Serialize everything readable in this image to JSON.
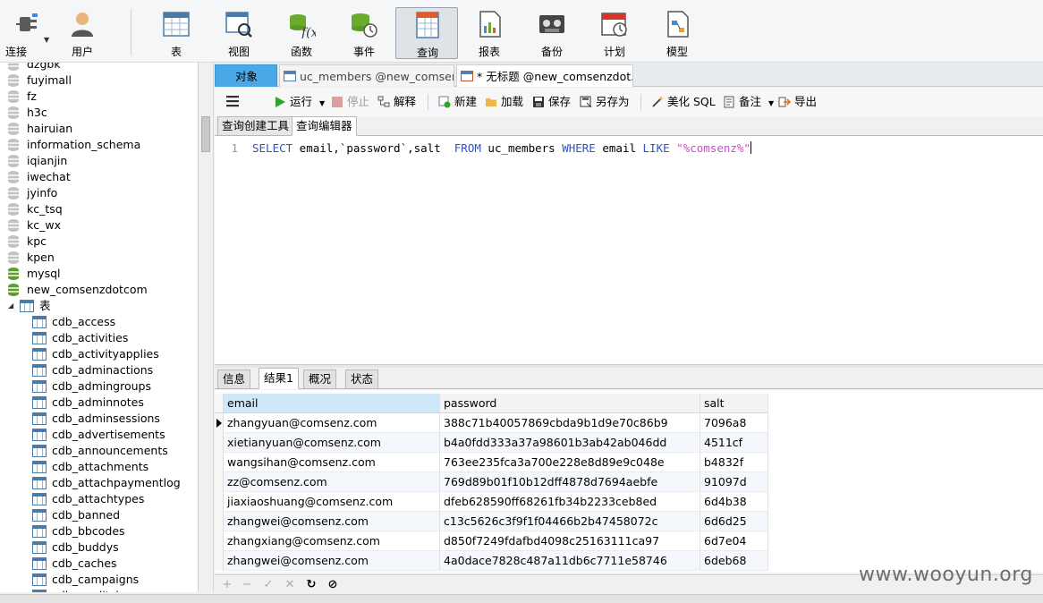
{
  "toolbar": {
    "connect": "连接",
    "user": "用户",
    "table": "表",
    "view": "视图",
    "function": "函数",
    "event": "事件",
    "query": "查询",
    "report": "报表",
    "backup": "备份",
    "schedule": "计划",
    "model": "模型"
  },
  "tree": {
    "top_partial": "dzgbk",
    "databases": [
      "fuyimall",
      "fz",
      "h3c",
      "hairuian",
      "information_schema",
      "iqianjin",
      "iwechat",
      "jyinfo",
      "kc_tsq",
      "kc_wx",
      "kpc",
      "kpen",
      "mysql",
      "new_comsenzdotcom"
    ],
    "tables_node": "表",
    "tables": [
      "cdb_access",
      "cdb_activities",
      "cdb_activityapplies",
      "cdb_adminactions",
      "cdb_admingroups",
      "cdb_adminnotes",
      "cdb_adminsessions",
      "cdb_advertisements",
      "cdb_announcements",
      "cdb_attachments",
      "cdb_attachpaymentlog",
      "cdb_attachtypes",
      "cdb_banned",
      "cdb_bbcodes",
      "cdb_buddys",
      "cdb_caches",
      "cdb_campaigns",
      "cdb_creditslog"
    ]
  },
  "tabs": {
    "objects": "对象",
    "tab1": "uc_members @new_comsen...",
    "tab2": "* 无标题 @new_comsenzdot..."
  },
  "qtoolbar": {
    "run": "运行",
    "stop": "停止",
    "explain": "解释",
    "new": "新建",
    "load": "加载",
    "save": "保存",
    "save_as": "另存为",
    "beautify": "美化 SQL",
    "comment": "备注",
    "export": "导出"
  },
  "editor_tabs": {
    "builder": "查询创建工具",
    "editor": "查询编辑器"
  },
  "editor": {
    "line_no": "1",
    "kw_select": "SELECT",
    "cols": " email,`password`,salt  ",
    "kw_from": "FROM",
    "table": " uc_members ",
    "kw_where": "WHERE",
    "field": " email ",
    "kw_like": "LIKE",
    "pattern": "\"%comsenz%\""
  },
  "result_tabs": {
    "info": "信息",
    "result1": "结果1",
    "overview": "概况",
    "status": "状态"
  },
  "grid": {
    "columns": [
      "email",
      "password",
      "salt"
    ],
    "rows": [
      [
        "zhangyuan@comsenz.com",
        "388c71b40057869cbda9b1d9e70c86b9",
        "7096a8"
      ],
      [
        "xietianyuan@comsenz.com",
        "b4a0fdd333a37a98601b3ab42ab046dd",
        "4511cf"
      ],
      [
        "wangsihan@comsenz.com",
        "763ee235fca3a700e228e8d89e9c048e",
        "b4832f"
      ],
      [
        "zz@comsenz.com",
        "769d89b01f10b12dff4878d7694aebfe",
        "91097d"
      ],
      [
        "jiaxiaoshuang@comsenz.com",
        "dfeb628590ff68261fb34b2233ceb8ed",
        "6d4b38"
      ],
      [
        "zhangwei@comsenz.com",
        "c13c5626c3f9f1f04466b2b47458072c",
        "6d6d25"
      ],
      [
        "zhangxiang@comsenz.com",
        "d850f7249fdafbd4098c25163111ca97",
        "6d7e04"
      ],
      [
        "zhangwei@comsenz.com",
        "4a0dace7828c487a11db6c7711e58746",
        "6deb68"
      ]
    ]
  },
  "watermark": "www.wooyun.org",
  "colors": {
    "accent": "#4ba8e8",
    "keyword": "#2b54c8",
    "string": "#c94fc9"
  }
}
